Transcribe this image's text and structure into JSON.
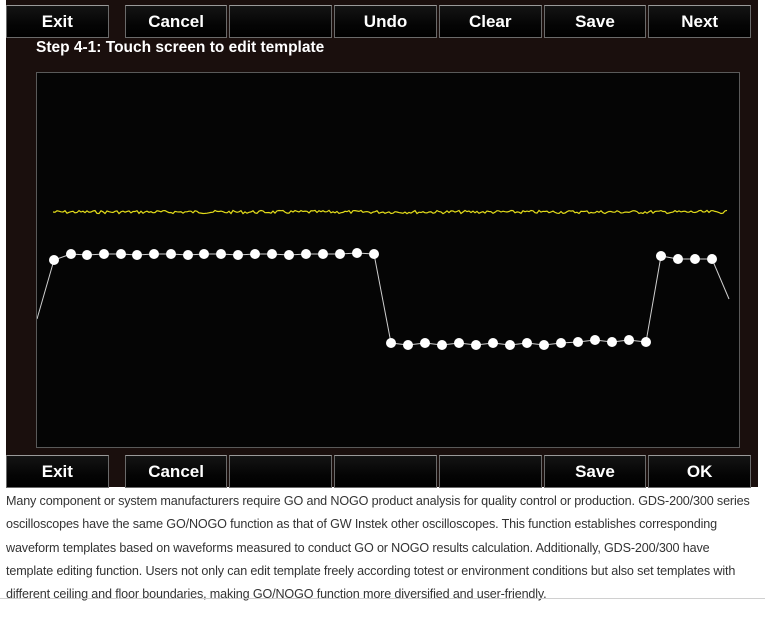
{
  "top_buttons": {
    "exit": "Exit",
    "cancel": "Cancel",
    "blank": "",
    "undo": "Undo",
    "clear": "Clear",
    "save": "Save",
    "next": "Next"
  },
  "step_text": "Step 4-1: Touch screen to edit template",
  "bottom_buttons": {
    "exit": "Exit",
    "cancel": "Cancel",
    "blank1": "",
    "blank2": "",
    "blank3": "",
    "save": "Save",
    "ok": "OK"
  },
  "colors": {
    "screen_bg": "#1a0f0d",
    "trace": "#e3dc1a",
    "template": "#ffffff"
  },
  "description": "Many component or system manufacturers require GO and NOGO product analysis for quality control or production. GDS-200/300 series oscilloscopes have the same GO/NOGO function as that of GW Instek other oscilloscopes. This function establishes corresponding waveform templates based on waveforms measured to conduct GO or NOGO results calculation. Additionally, GDS-200/300 have template editing function. Users not only can edit template freely according totest or environment conditions but also set templates with different ceiling and floor boundaries, making GO/NOGO function more diversified and user-friendly."
}
